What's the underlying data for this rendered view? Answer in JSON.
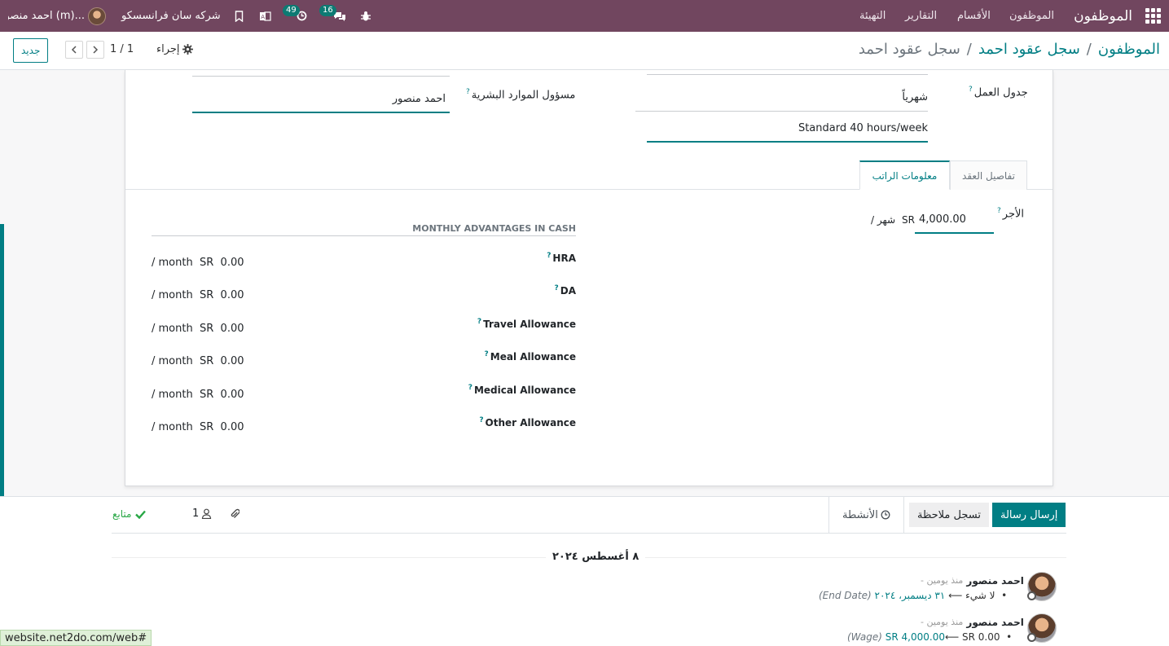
{
  "navbar": {
    "brand": "الموظفون",
    "menu": [
      "الموظفون",
      "الأقسام",
      "التقارير",
      "التهيئة"
    ],
    "activities_count": "49",
    "messages_count": "16",
    "company": "شركه سان فرانسسكو",
    "user": "احمد منصور (m)..."
  },
  "control_panel": {
    "new_button": "جديد",
    "pager": "1 / 1",
    "action": "إجراء",
    "breadcrumb": [
      "الموظفون",
      "سجل عقود احمد",
      "سجل عقود احمد"
    ]
  },
  "form": {
    "hr_responsible_label": "مسؤول الموارد البشرية",
    "hr_responsible_value": "احمد منصور",
    "schedule_label": "جدول العمل",
    "schedule_pay_value": "شهرياً",
    "working_hours_value": "Standard 40 hours/week",
    "tabs": [
      "تفاصيل العقد",
      "معلومات الراتب"
    ],
    "wage_label": "الأجر",
    "wage_value": "4,000.00",
    "wage_currency": "SR",
    "wage_period": "/ شهر",
    "advantages_title": "MONTHLY ADVANTAGES IN CASH",
    "advantages": [
      {
        "label": "HRA",
        "value": "0.00",
        "currency": "SR",
        "period": "/ month"
      },
      {
        "label": "DA",
        "value": "0.00",
        "currency": "SR",
        "period": "/ month"
      },
      {
        "label": "Travel Allowance",
        "value": "0.00",
        "currency": "SR",
        "period": "/ month"
      },
      {
        "label": "Meal Allowance",
        "value": "0.00",
        "currency": "SR",
        "period": "/ month"
      },
      {
        "label": "Medical Allowance",
        "value": "0.00",
        "currency": "SR",
        "period": "/ month"
      },
      {
        "label": "Other Allowance",
        "value": "0.00",
        "currency": "SR",
        "period": "/ month"
      }
    ]
  },
  "chatter": {
    "send_message": "إرسال رسالة",
    "log_note": "تسجل ملاحظة",
    "activities": "الأنشطة",
    "followers_count": "1",
    "follow_status": "متابع",
    "date_separator": "٨ أغسطس ٢٠٢٤",
    "messages": [
      {
        "author": "احمد منصور",
        "time": "- منذ يومين",
        "old": "لا شيء",
        "arrow": "⟵",
        "new": "٣١ ديسمبر، ٢٠٢٤",
        "field": "(End Date)"
      },
      {
        "author": "احمد منصور",
        "time": "- منذ يومين",
        "old": "SR 0.00",
        "arrow": "⟵",
        "new": "SR 4,000.00",
        "field": "(Wage)"
      }
    ]
  },
  "status_url": "website.net2do.com/web#"
}
